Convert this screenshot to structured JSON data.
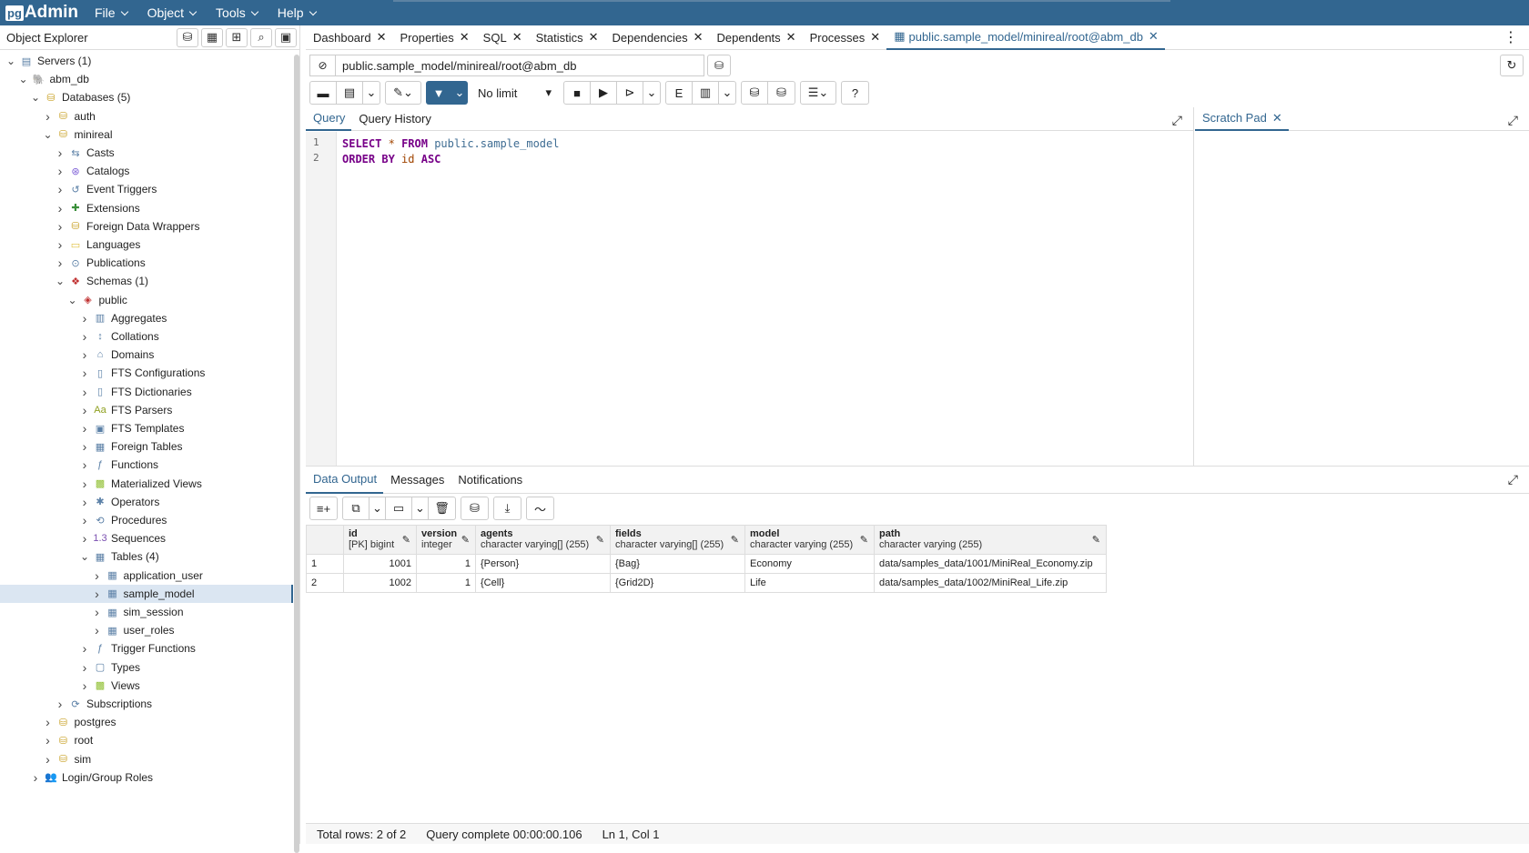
{
  "app": {
    "logo_pg": "pg",
    "logo_text": "Admin"
  },
  "menus": [
    "File",
    "Object",
    "Tools",
    "Help"
  ],
  "explorer": {
    "title": "Object Explorer"
  },
  "tree": [
    {
      "label": "Servers (1)",
      "depth": 0,
      "expanded": true,
      "icon": "servers-icon"
    },
    {
      "label": "abm_db",
      "depth": 1,
      "expanded": true,
      "icon": "server-icon"
    },
    {
      "label": "Databases (5)",
      "depth": 2,
      "expanded": true,
      "icon": "databases-icon"
    },
    {
      "label": "auth",
      "depth": 3,
      "expanded": false,
      "icon": "database-icon"
    },
    {
      "label": "minireal",
      "depth": 3,
      "expanded": true,
      "icon": "database-icon"
    },
    {
      "label": "Casts",
      "depth": 4,
      "expanded": false,
      "icon": "casts-icon"
    },
    {
      "label": "Catalogs",
      "depth": 4,
      "expanded": false,
      "icon": "catalogs-icon"
    },
    {
      "label": "Event Triggers",
      "depth": 4,
      "expanded": false,
      "icon": "event-triggers-icon"
    },
    {
      "label": "Extensions",
      "depth": 4,
      "expanded": false,
      "icon": "extensions-icon"
    },
    {
      "label": "Foreign Data Wrappers",
      "depth": 4,
      "expanded": false,
      "icon": "fdw-icon"
    },
    {
      "label": "Languages",
      "depth": 4,
      "expanded": false,
      "icon": "languages-icon"
    },
    {
      "label": "Publications",
      "depth": 4,
      "expanded": false,
      "icon": "publications-icon"
    },
    {
      "label": "Schemas (1)",
      "depth": 4,
      "expanded": true,
      "icon": "schemas-icon"
    },
    {
      "label": "public",
      "depth": 5,
      "expanded": true,
      "icon": "schema-icon"
    },
    {
      "label": "Aggregates",
      "depth": 6,
      "expanded": false,
      "icon": "aggregates-icon"
    },
    {
      "label": "Collations",
      "depth": 6,
      "expanded": false,
      "icon": "collations-icon"
    },
    {
      "label": "Domains",
      "depth": 6,
      "expanded": false,
      "icon": "domains-icon"
    },
    {
      "label": "FTS Configurations",
      "depth": 6,
      "expanded": false,
      "icon": "fts-config-icon"
    },
    {
      "label": "FTS Dictionaries",
      "depth": 6,
      "expanded": false,
      "icon": "fts-dict-icon"
    },
    {
      "label": "FTS Parsers",
      "depth": 6,
      "expanded": false,
      "icon": "fts-parser-icon"
    },
    {
      "label": "FTS Templates",
      "depth": 6,
      "expanded": false,
      "icon": "fts-template-icon"
    },
    {
      "label": "Foreign Tables",
      "depth": 6,
      "expanded": false,
      "icon": "foreign-tables-icon"
    },
    {
      "label": "Functions",
      "depth": 6,
      "expanded": false,
      "icon": "functions-icon"
    },
    {
      "label": "Materialized Views",
      "depth": 6,
      "expanded": false,
      "icon": "mviews-icon"
    },
    {
      "label": "Operators",
      "depth": 6,
      "expanded": false,
      "icon": "operators-icon"
    },
    {
      "label": "Procedures",
      "depth": 6,
      "expanded": false,
      "icon": "procedures-icon"
    },
    {
      "label": "Sequences",
      "depth": 6,
      "expanded": false,
      "icon": "sequences-icon"
    },
    {
      "label": "Tables (4)",
      "depth": 6,
      "expanded": true,
      "icon": "tables-icon"
    },
    {
      "label": "application_user",
      "depth": 7,
      "expanded": false,
      "icon": "table-icon"
    },
    {
      "label": "sample_model",
      "depth": 7,
      "expanded": false,
      "icon": "table-icon",
      "selected": true
    },
    {
      "label": "sim_session",
      "depth": 7,
      "expanded": false,
      "icon": "table-icon"
    },
    {
      "label": "user_roles",
      "depth": 7,
      "expanded": false,
      "icon": "table-icon"
    },
    {
      "label": "Trigger Functions",
      "depth": 6,
      "expanded": false,
      "icon": "trigger-functions-icon"
    },
    {
      "label": "Types",
      "depth": 6,
      "expanded": false,
      "icon": "types-icon"
    },
    {
      "label": "Views",
      "depth": 6,
      "expanded": false,
      "icon": "views-icon"
    },
    {
      "label": "Subscriptions",
      "depth": 4,
      "expanded": false,
      "icon": "subscriptions-icon"
    },
    {
      "label": "postgres",
      "depth": 3,
      "expanded": false,
      "icon": "database-icon"
    },
    {
      "label": "root",
      "depth": 3,
      "expanded": false,
      "icon": "database-icon"
    },
    {
      "label": "sim",
      "depth": 3,
      "expanded": false,
      "icon": "database-icon"
    },
    {
      "label": "Login/Group Roles",
      "depth": 2,
      "expanded": false,
      "icon": "roles-icon"
    }
  ],
  "tabs": [
    "Dashboard",
    "Properties",
    "SQL",
    "Statistics",
    "Dependencies",
    "Dependents",
    "Processes"
  ],
  "active_tab": "public.sample_model/minireal/root@abm_db",
  "connection": "public.sample_model/minireal/root@abm_db",
  "limit": "No limit",
  "editor_tabs": {
    "query": "Query",
    "history": "Query History",
    "scratch": "Scratch Pad"
  },
  "sql_lines": [
    {
      "n": "1",
      "parts": [
        {
          "t": "SELECT",
          "c": "kw"
        },
        {
          "t": " ",
          "c": ""
        },
        {
          "t": "*",
          "c": "cl"
        },
        {
          "t": " ",
          "c": ""
        },
        {
          "t": "FROM",
          "c": "kw"
        },
        {
          "t": " ",
          "c": ""
        },
        {
          "t": "public.sample_model",
          "c": "tb"
        }
      ]
    },
    {
      "n": "2",
      "parts": [
        {
          "t": "ORDER BY",
          "c": "kw"
        },
        {
          "t": " ",
          "c": ""
        },
        {
          "t": "id",
          "c": "cl"
        },
        {
          "t": " ",
          "c": ""
        },
        {
          "t": "ASC",
          "c": "kw"
        }
      ]
    }
  ],
  "output_tabs": [
    "Data Output",
    "Messages",
    "Notifications"
  ],
  "columns": [
    {
      "name": "id",
      "type": "[PK] bigint",
      "width": 80
    },
    {
      "name": "version",
      "type": "integer",
      "width": 65
    },
    {
      "name": "agents",
      "type": "character varying[] (255)",
      "width": 148
    },
    {
      "name": "fields",
      "type": "character varying[] (255)",
      "width": 148
    },
    {
      "name": "model",
      "type": "character varying (255)",
      "width": 142
    },
    {
      "name": "path",
      "type": "character varying (255)",
      "width": 255
    }
  ],
  "rows": [
    {
      "rn": "1",
      "cells": [
        "1001",
        "1",
        "{Person}",
        "{Bag}",
        "Economy",
        "data/samples_data/1001/MiniReal_Economy.zip"
      ]
    },
    {
      "rn": "2",
      "cells": [
        "1002",
        "1",
        "{Cell}",
        "{Grid2D}",
        "Life",
        "data/samples_data/1002/MiniReal_Life.zip"
      ]
    }
  ],
  "status": {
    "rows": "Total rows: 2 of 2",
    "query": "Query complete 00:00:00.106",
    "cursor": "Ln 1, Col 1"
  }
}
